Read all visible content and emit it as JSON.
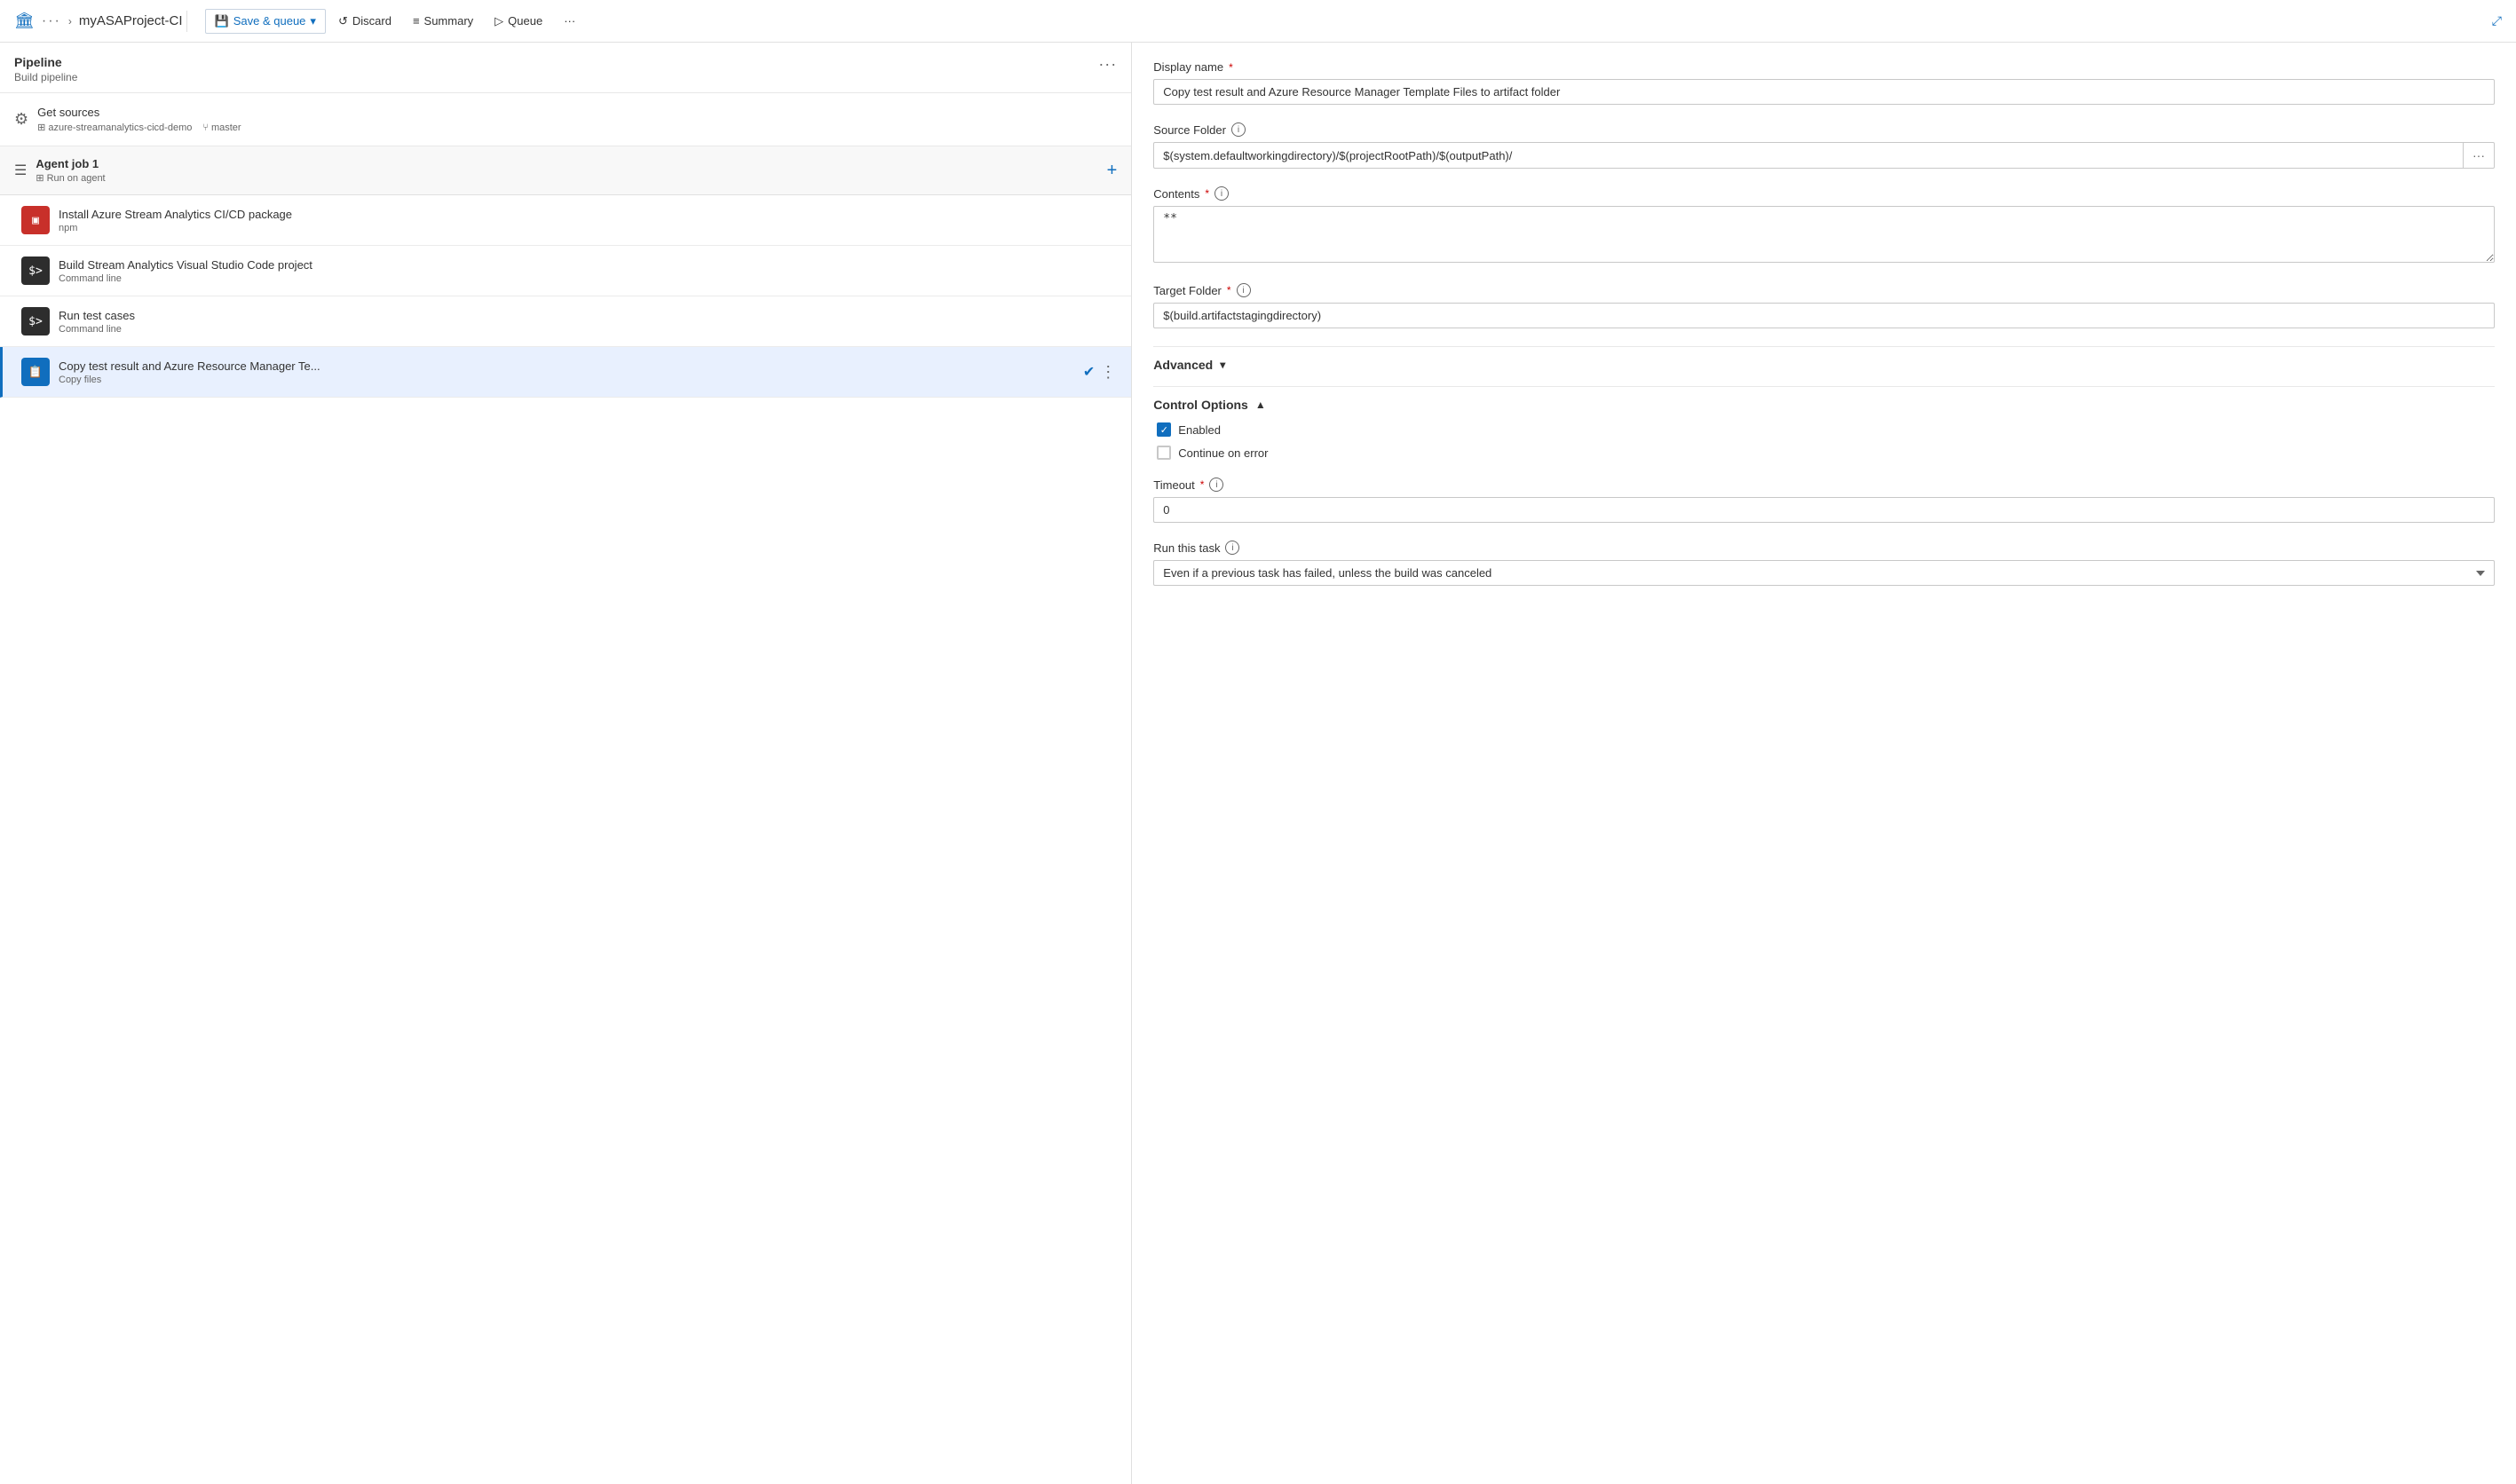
{
  "topbar": {
    "icon": "🏛",
    "dots": "···",
    "chevron": "›",
    "project": "myASAProject-CI",
    "save_queue_label": "Save & queue",
    "discard_label": "Discard",
    "summary_label": "Summary",
    "queue_label": "Queue",
    "more_dots": "···",
    "expand_icon": "⤢"
  },
  "left_panel": {
    "pipeline_title": "Pipeline",
    "pipeline_subtitle": "Build pipeline",
    "more_icon": "···",
    "get_sources": {
      "title": "Get sources",
      "repo": "azure-streamanalytics-cicd-demo",
      "branch": "master"
    },
    "agent_job": {
      "title": "Agent job 1",
      "subtitle": "Run on agent"
    },
    "tasks": [
      {
        "id": "task-1",
        "name": "Install Azure Stream Analytics CI/CD package",
        "type": "npm",
        "icon_type": "red",
        "icon_text": "▣",
        "selected": false
      },
      {
        "id": "task-2",
        "name": "Build Stream Analytics Visual Studio Code project",
        "type": "Command line",
        "icon_type": "dark",
        "icon_text": ">_",
        "selected": false
      },
      {
        "id": "task-3",
        "name": "Run test cases",
        "type": "Command line",
        "icon_type": "dark",
        "icon_text": ">_",
        "selected": false
      },
      {
        "id": "task-4",
        "name": "Copy test result and Azure Resource Manager Te...",
        "type": "Copy files",
        "icon_type": "blue",
        "icon_text": "⧉",
        "selected": true
      }
    ]
  },
  "right_panel": {
    "display_name_label": "Display name",
    "display_name_required": "*",
    "display_name_value": "Copy test result and Azure Resource Manager Template Files to artifact folder",
    "source_folder_label": "Source Folder",
    "source_folder_value": "$(system.defaultworkingdirectory)/$(projectRootPath)/$(outputPath)/",
    "contents_label": "Contents",
    "contents_required": "*",
    "contents_value": "**",
    "target_folder_label": "Target Folder",
    "target_folder_required": "*",
    "target_folder_value": "$(build.artifactstagingdirectory)",
    "advanced_label": "Advanced",
    "control_options_label": "Control Options",
    "enabled_label": "Enabled",
    "continue_on_error_label": "Continue on error",
    "timeout_label": "Timeout",
    "timeout_required": "*",
    "timeout_value": "0",
    "run_this_task_label": "Run this task",
    "run_this_task_value": "Even if a previous task has failed, unless the build was canceled"
  }
}
